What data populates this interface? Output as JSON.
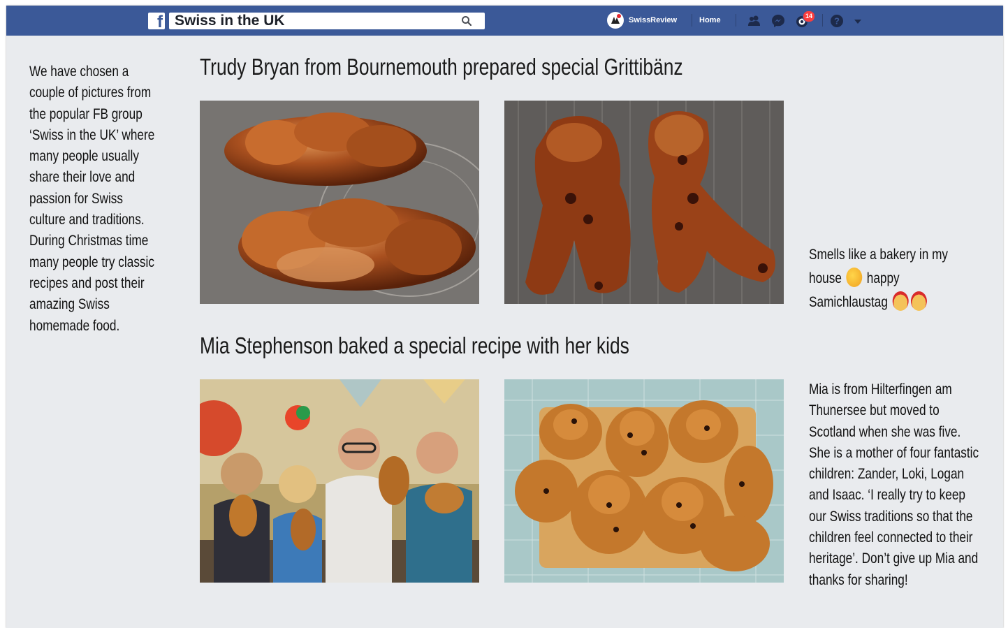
{
  "topbar": {
    "search_value": "Swiss in the UK",
    "profile_name": "SwissReview",
    "home_label": "Home",
    "notification_count": "14",
    "brand_color": "#3b5998",
    "icons": [
      "facebook-logo-icon",
      "search-icon",
      "friends-icon",
      "messenger-icon",
      "notifications-icon",
      "help-icon",
      "caret-down-icon"
    ]
  },
  "intro": {
    "text": "We have chosen a couple of pictures from the popular FB group ‘Swiss in the UK’ where many people usually share their love and passion for Swiss culture and traditions. During Christmas time many people try classic recipes and post their amazing Swiss homemade food."
  },
  "sections": [
    {
      "heading": "Trudy Bryan from Bournemouth prepared special Grittibänz",
      "note_before": "Smells like a bakery in my house",
      "note_middle": "happy Samichlaustag"
    },
    {
      "heading": "Mia Stephenson baked a special recipe with her kids",
      "note": "Mia is from Hilterfingen am Thunersee but moved to Scotland when she was five. She is a mother of four fantastic children: Zander, Loki, Logan and Isaac. ‘I really try to keep our Swiss traditions so that the children feel connected to their heritage’. Don’t give up Mia and thanks for sharing!"
    }
  ]
}
